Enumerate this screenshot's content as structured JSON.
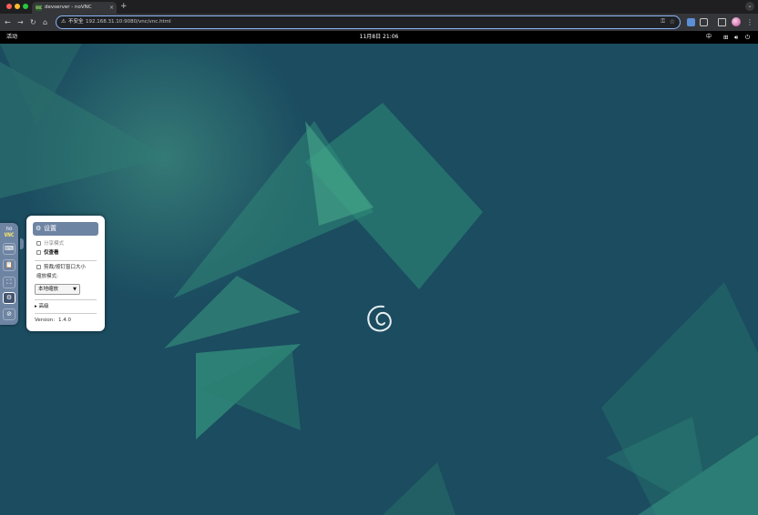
{
  "browser": {
    "tab_title": "devserver - noVNC",
    "favicon_text": "VNC",
    "tab_close": "×",
    "new_tab": "+",
    "tab_menu": "⌄",
    "nav": {
      "back": "←",
      "forward": "→",
      "reload": "↻",
      "home": "⌂"
    },
    "security_label": "不安全",
    "url": "192.168.31.10:9080/vnc/vnc.html",
    "menu": "⋮"
  },
  "gnome": {
    "activities": "活动",
    "clock": "11月8日  21:06",
    "input_method": "中"
  },
  "novnc": {
    "logo_top": "no",
    "logo_bottom": "VNC",
    "buttons": {
      "extra_keys": "⌨",
      "clipboard": "📋",
      "fullscreen": "⛶",
      "settings": "⚙",
      "disconnect": "⊘"
    },
    "settings": {
      "title": "设置",
      "shared_mode": "分享模式",
      "view_only": "仅查看",
      "clip_resize": "剪裁/按钉窗口大小",
      "scaling_label": "缩放模式:",
      "scaling_value": "本地缩放",
      "advanced": "▸ 高级",
      "version_label": "Version:",
      "version_value": "1.4.0"
    }
  },
  "colors": {
    "accent": "#8ab4f8",
    "novnc_blue": "#6e84a3",
    "desktop": "#1b4c60"
  }
}
